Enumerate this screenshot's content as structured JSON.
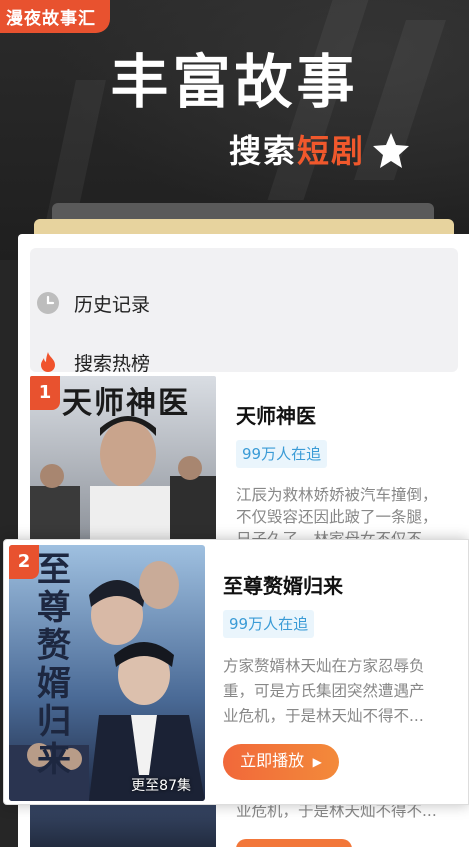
{
  "app_tag": "漫夜故事汇",
  "hero": {
    "title": "丰富故事",
    "subtitle_plain": "搜索",
    "subtitle_accent": "短剧",
    "star_icon": "star-icon"
  },
  "menu": [
    {
      "icon": "clock-icon",
      "label": "历史记录"
    },
    {
      "icon": "flame-icon",
      "label": "搜索热榜"
    }
  ],
  "list": [
    {
      "rank": "1",
      "poster_text": "天师神医",
      "title": "天师神医",
      "followers": "99万人在追",
      "desc_lines": [
        "江辰为救林娇娇被汽车撞倒，",
        "不仅毁容还因此跛了一条腿，",
        "日子久了，林家母女不仅不"
      ]
    }
  ],
  "featured": {
    "rank": "2",
    "poster_text": "至尊赘婿归来",
    "title": "至尊赘婿归来",
    "followers": "99万人在追",
    "desc_lines": [
      "方家赘婿林天灿在方家忍辱负",
      "重，可是方氏集团突然遭遇产",
      "业危机，于是林天灿不得不..."
    ],
    "episodes": "更至87集",
    "play_label": "立即播放"
  },
  "below_peek": {
    "desc_line": "业危机，于是林天灿不得不..."
  },
  "colors": {
    "accent": "#e8522f",
    "badge_text": "#3a9bd6",
    "badge_bg": "#eaf5fc",
    "background": "#262626"
  }
}
